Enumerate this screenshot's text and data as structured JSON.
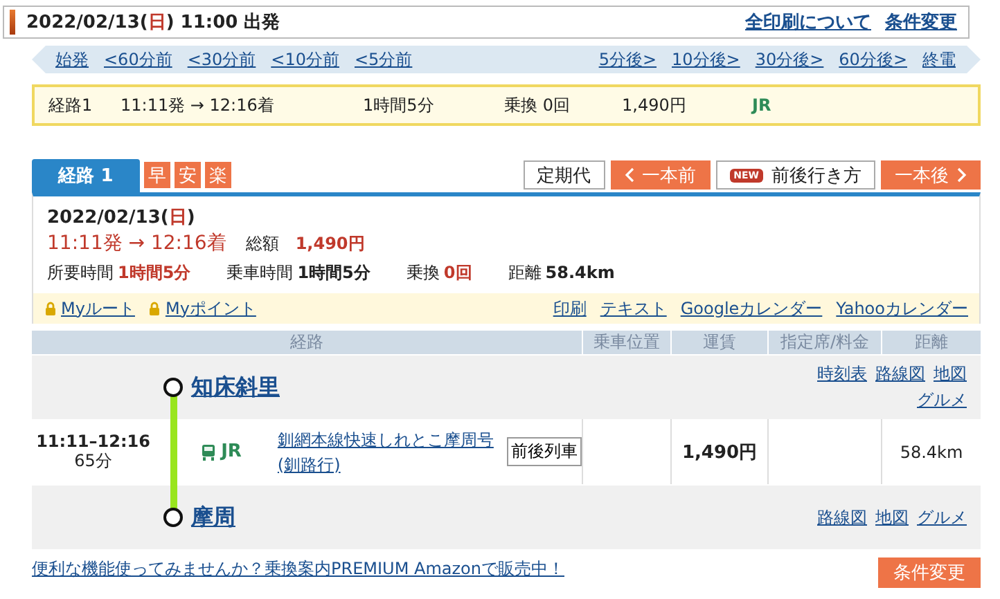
{
  "header": {
    "date": "2022/02/13(",
    "weekday": "日",
    "rest": ") 11:00 出発",
    "links": [
      "全印刷について",
      "条件変更"
    ]
  },
  "nav": {
    "earlier": [
      "始発",
      "<60分前",
      "<30分前",
      "<10分前",
      "<5分前"
    ],
    "later": [
      "5分後>",
      "10分後>",
      "30分後>",
      "60分後>",
      "終電"
    ]
  },
  "summary": {
    "route": "経路1",
    "times": "11:11発 → 12:16着",
    "duration": "1時間5分",
    "transfers": "乗換 0回",
    "fare": "1,490円",
    "operator": "JR"
  },
  "tabs": [
    {
      "label": "経路 1",
      "selected": true
    }
  ],
  "badges": [
    "早",
    "安",
    "楽"
  ],
  "actions": [
    {
      "kind": "plain",
      "label": "定期代"
    },
    {
      "kind": "prev",
      "label": "一本前"
    },
    {
      "kind": "new",
      "badge": "NEW",
      "label": "前後行き方"
    },
    {
      "kind": "next",
      "label": "一本後"
    }
  ],
  "detail": {
    "date": "2022/02/13(",
    "weekday": "日",
    "date_end": ")",
    "times": "11:11発 → 12:16着",
    "total_label": "総額",
    "total": "1,490円",
    "stats": [
      {
        "label": "所要時間",
        "value": "1時間5分",
        "kind": "alert"
      },
      {
        "label": "乗車時間",
        "value": "1時間5分",
        "kind": "plain"
      },
      {
        "label": "乗換",
        "value": "0回",
        "kind": "alert"
      },
      {
        "label": "距離",
        "value": "58.4km",
        "kind": "plain"
      }
    ]
  },
  "tools": {
    "saved": [
      {
        "label": "Myルート",
        "locked": true
      },
      {
        "label": "Myポイント",
        "locked": true
      }
    ],
    "links": [
      "印刷",
      "テキスト",
      "Googleカレンダー",
      "Yahooカレンダー"
    ]
  },
  "table": {
    "columns": [
      "経路",
      "乗車位置",
      "運賃",
      "指定席/料金",
      "距離"
    ],
    "stations": [
      {
        "name": "知床斜里",
        "links": [
          "時刻表",
          "路線図",
          "地図",
          "グルメ"
        ]
      },
      {
        "name": "摩周",
        "links": [
          "路線図",
          "地図",
          "グルメ"
        ]
      }
    ],
    "segment": {
      "time": "11:11–12:16",
      "duration": "65分",
      "operator": "JR",
      "train": "釧網本線快速しれとこ摩周号",
      "destination": "(釧路行)",
      "button": "前後列車",
      "fare": "1,490円",
      "distance": "58.4km",
      "color": "#99e51f"
    }
  },
  "footer": {
    "promo": "便利な機能使ってみませんか？乗換案内PREMIUM Amazonで販売中！",
    "button": "条件変更"
  }
}
